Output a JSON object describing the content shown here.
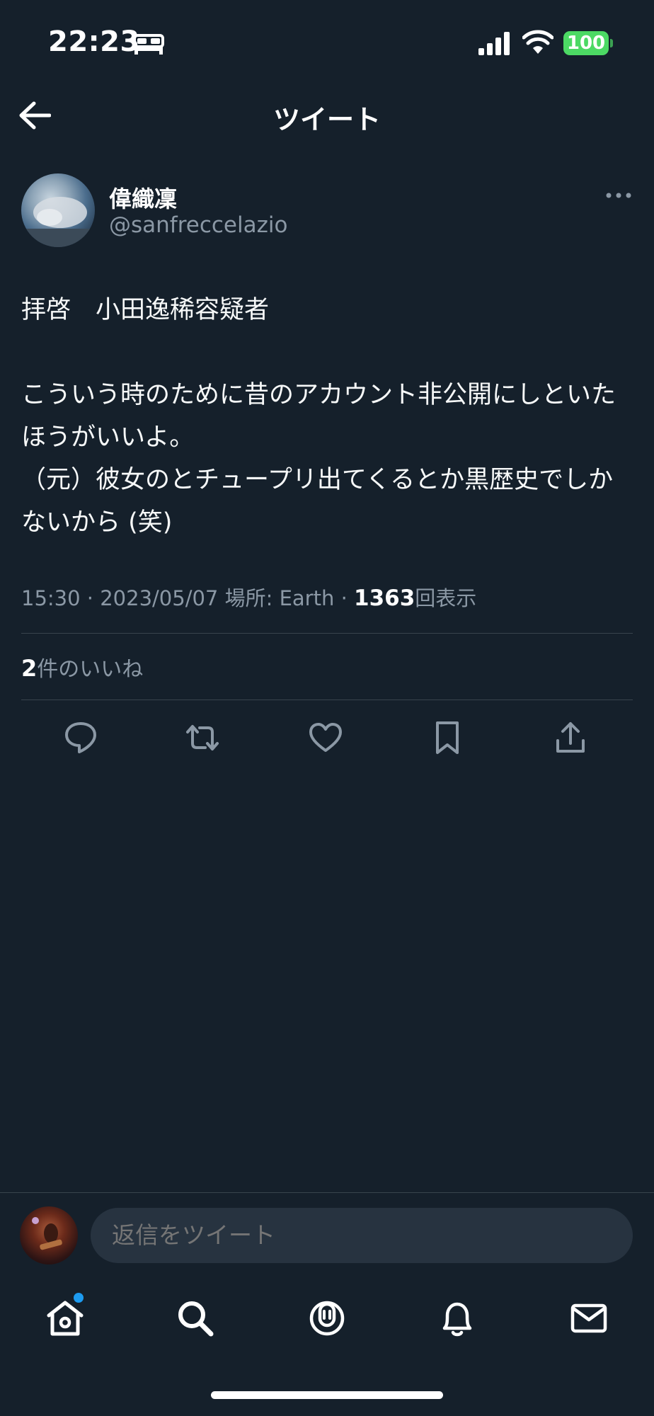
{
  "status_bar": {
    "time": "22:23",
    "battery": "100",
    "icons": [
      "bed-icon",
      "cellular-signal-icon",
      "wifi-icon",
      "battery-icon"
    ]
  },
  "header": {
    "title": "ツイート",
    "back_icon": "arrow-left-icon"
  },
  "tweet": {
    "author_name": "偉織凜",
    "author_handle": "@sanfreccelazio",
    "text": "拝啓　小田逸稀容疑者\n\nこういう時のために昔のアカウント非公開にしといたほうがいいよ。\n（元）彼女のとチュープリ出てくるとか黒歴史でしかないから (笑)",
    "meta_time": "15:30 · 2023/05/07 場所: Earth · ",
    "view_count": "1363",
    "view_label": "回表示",
    "like_count": "2",
    "like_label": "件のいいね"
  },
  "actions": [
    "reply-icon",
    "retweet-icon",
    "like-icon",
    "bookmark-icon",
    "share-icon"
  ],
  "reply": {
    "placeholder": "返信をツイート"
  },
  "nav": [
    "home-icon",
    "search-icon",
    "spaces-icon",
    "notifications-icon",
    "messages-icon"
  ],
  "colors": {
    "background": "#15202b",
    "text": "#f7f9f9",
    "secondary": "#8b98a5",
    "accent": "#1d9bf0",
    "battery": "#4cd964"
  }
}
